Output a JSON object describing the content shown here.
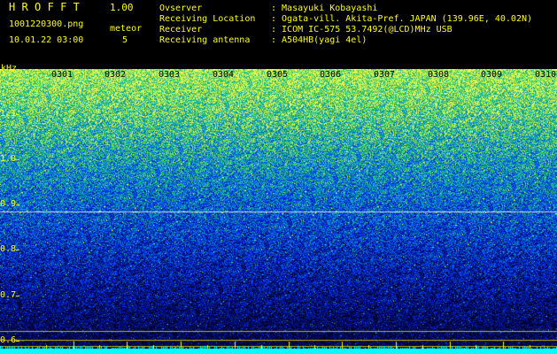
{
  "header": {
    "app_name": "HROFFT",
    "app_version": "1.00",
    "file_name": "1001220300.png",
    "meteor_label": "meteor",
    "date_time": "10.01.22 03:00",
    "meteor_count": "5"
  },
  "info": [
    {
      "key": "Ovserver",
      "value": ": Masayuki Kobayashi"
    },
    {
      "key": "Receiving Location",
      "value": ": Ogata-vill. Akita-Pref. JAPAN (139.96E, 40.02N)"
    },
    {
      "key": "Receiver",
      "value": ": ICOM IC-575 53.7492(@LCD)MHz USB"
    },
    {
      "key": "Receiving antenna",
      "value": ": A504HB(yagi 4el)"
    }
  ],
  "spectrogram": {
    "y_unit": "kHz",
    "y_ticks": [
      "1.1",
      "1.0",
      "0.9",
      "0.8",
      "0.7",
      "0.6"
    ],
    "y_range": [
      0.57,
      1.2
    ],
    "x_ticks": [
      "0301",
      "0302",
      "0303",
      "0304",
      "0305",
      "0306",
      "0307",
      "0308",
      "0309",
      "0310"
    ],
    "x_range_minutes": [
      0,
      10
    ],
    "horizontal_lines_khz": [
      0.885,
      0.62,
      0.602,
      0.588
    ],
    "colors": {
      "text": "#ffff00",
      "tick_marks": "#ffff00",
      "line": "#dddddd",
      "baseline": "#00ffff"
    }
  }
}
